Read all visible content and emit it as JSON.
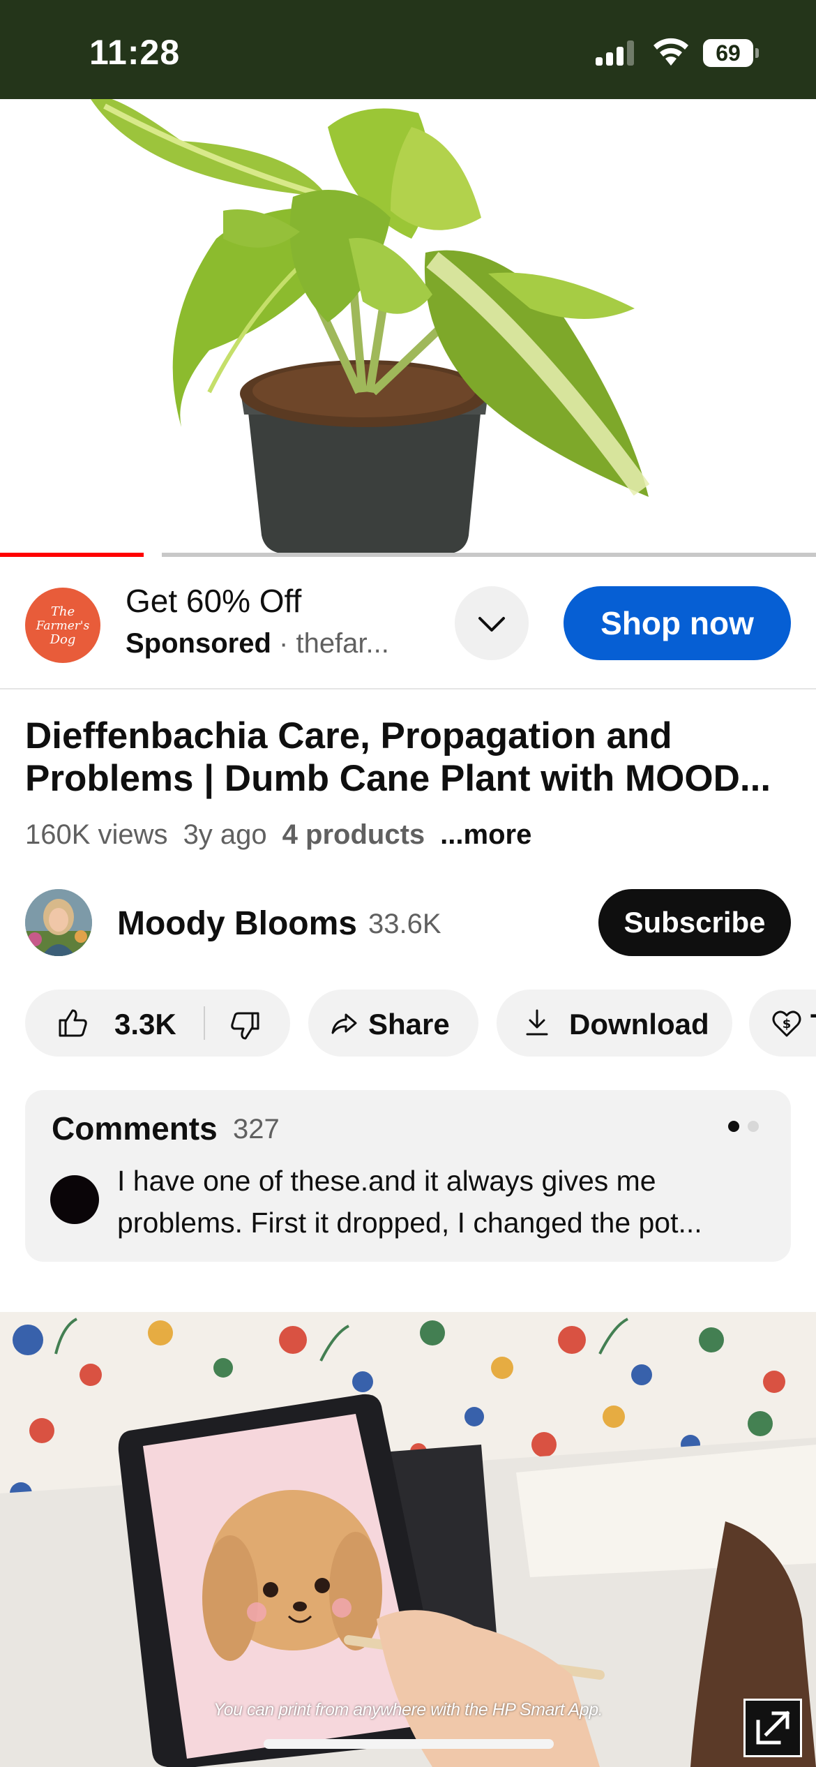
{
  "status_bar": {
    "time": "11:28",
    "battery": "69"
  },
  "ad": {
    "brand_logo_text": "The Farmer's Dog",
    "title": "Get 60% Off",
    "sponsored_label": "Sponsored",
    "separator": " · ",
    "domain": "thefar...",
    "cta_label": "Shop now",
    "accent_color": "#065fd4"
  },
  "video": {
    "progress_fraction": 0.176,
    "progress_color": "#ff0000",
    "title_line1": "Dieffenbachia Care, Propagation and",
    "title_line2": "Problems | Dumb Cane Plant with MOOD...",
    "views": "160K views",
    "age": "3y ago",
    "products": "4 products",
    "more_label": "...more"
  },
  "channel": {
    "name": "Moody Blooms",
    "subscribers": "33.6K",
    "subscribe_label": "Subscribe"
  },
  "actions": {
    "like_count": "3.3K",
    "share_label": "Share",
    "download_label": "Download",
    "thanks_label": "T"
  },
  "comments": {
    "title": "Comments",
    "count": "327",
    "top_comment_line1": "I have one of these.and it always gives me",
    "top_comment_line2": "problems.  First it dropped, I changed the pot..."
  },
  "next_ad": {
    "caption": "You can print from anywhere with the HP Smart App."
  }
}
